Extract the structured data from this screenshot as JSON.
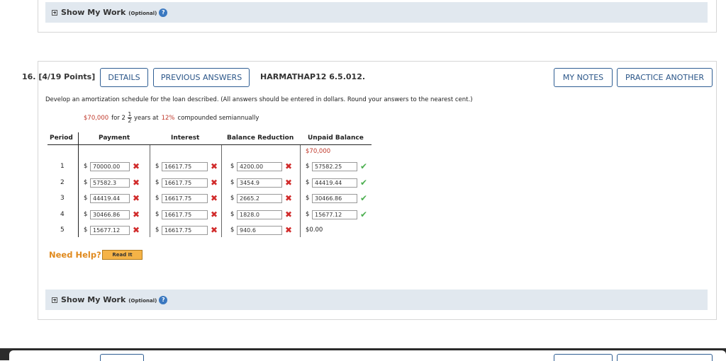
{
  "prev_question": {
    "show_my_work": "Show My Work",
    "optional": "(Optional)"
  },
  "question": {
    "number": "16.",
    "points": "[4/19 Points]",
    "details_label": "DETAILS",
    "previous_answers_label": "PREVIOUS ANSWERS",
    "question_id": "HARMATHAP12 6.5.012.",
    "my_notes_label": "MY NOTES",
    "practice_another_label": "PRACTICE ANOTHER",
    "instructions": "Develop an amortization schedule for the loan described. (All answers should be entered in dollars. Round your answers to the nearest cent.)",
    "loan": {
      "amount": "$70,000",
      "for_text": "for 2",
      "frac_num": "1",
      "frac_den": "2",
      "years_at": "years at",
      "rate": "12%",
      "compounding": "compounded semiannually"
    },
    "table": {
      "headers": [
        "Period",
        "Payment",
        "Interest",
        "Balance Reduction",
        "Unpaid Balance"
      ],
      "initial_balance": "$70,000",
      "rows": [
        {
          "period": "1",
          "payment": "70000.00",
          "interest": "16617.75",
          "reduction": "4200.00",
          "unpaid": "57582.25"
        },
        {
          "period": "2",
          "payment": "57582.3",
          "interest": "16617.75",
          "reduction": "3454.9",
          "unpaid": "44419.44"
        },
        {
          "period": "3",
          "payment": "44419.44",
          "interest": "16617.75",
          "reduction": "2665.2",
          "unpaid": "30466.86"
        },
        {
          "period": "4",
          "payment": "30466.86",
          "interest": "16617.75",
          "reduction": "1828.0",
          "unpaid": "15677.12"
        },
        {
          "period": "5",
          "payment": "15677.12",
          "interest": "16617.75",
          "reduction": "940.6",
          "unpaid": "$0.00"
        }
      ],
      "currency_symbol": "$",
      "wrong_mark": "✖",
      "correct_mark": "✔"
    },
    "need_help": "Need Help?",
    "read_it": "Read It",
    "show_my_work": "Show My Work",
    "optional": "(Optional)"
  },
  "colors": {
    "accent": "#2f5e93",
    "highlight_red": "#c0392b",
    "bar_bg": "#e1e8ef",
    "need_help": "#e08a1e"
  }
}
